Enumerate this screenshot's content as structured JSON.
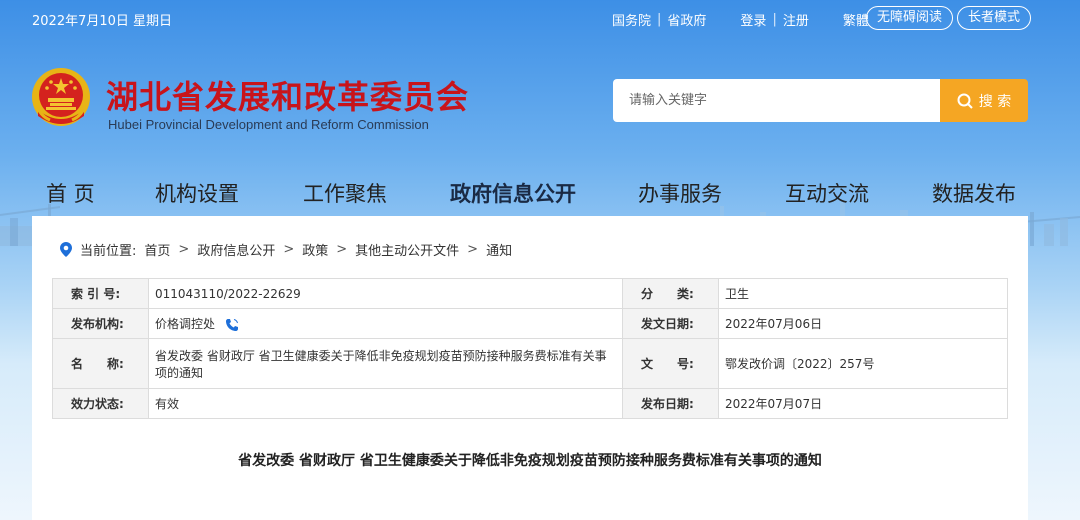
{
  "topbar": {
    "date": "2022年7月10日 星期日",
    "links": [
      "国务院",
      "省政府",
      "登录",
      "注册",
      "繁體"
    ],
    "accessible_mode": "无障碍阅读",
    "elder_mode": "长者模式"
  },
  "header": {
    "title": "湖北省发展和改革委员会",
    "subtitle": "Hubei Provincial Development and Reform Commission",
    "search_placeholder": "请输入关键字",
    "search_button": "搜 索"
  },
  "nav": {
    "items": [
      "首 页",
      "机构设置",
      "工作聚焦",
      "政府信息公开",
      "办事服务",
      "互动交流",
      "数据发布"
    ],
    "active_index": 3
  },
  "breadcrumb": {
    "prefix": "当前位置:",
    "items": [
      "首页",
      "政府信息公开",
      "政策",
      "其他主动公开文件",
      "通知"
    ]
  },
  "meta": {
    "index_label": "索 引 号:",
    "index_value": "011043110/2022-22629",
    "category_label": "分　　类:",
    "category_value": "卫生",
    "issuer_label": "发布机构:",
    "issuer_value": "价格调控处",
    "issue_date_label": "发文日期:",
    "issue_date_value": "2022年07月06日",
    "name_label": "名　　称:",
    "name_value": "省发改委 省财政厅 省卫生健康委关于降低非免疫规划疫苗预防接种服务费标准有关事项的通知",
    "docno_label": "文　　号:",
    "docno_value": "鄂发改价调〔2022〕257号",
    "status_label": "效力状态:",
    "status_value": "有效",
    "publish_date_label": "发布日期:",
    "publish_date_value": "2022年07月07日"
  },
  "doc_title": "省发改委 省财政厅 省卫生健康委关于降低非免疫规划疫苗预防接种服务费标准有关事项的通知",
  "colors": {
    "title_red": "#c8141b",
    "search_orange": "#f5a623",
    "accent_blue": "#1e6fd9"
  }
}
